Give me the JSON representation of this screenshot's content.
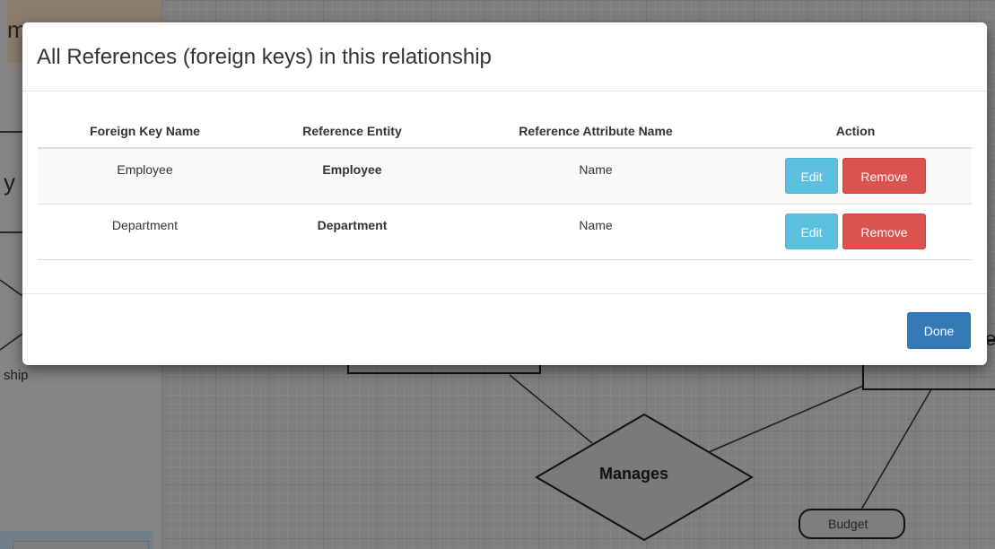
{
  "background": {
    "left_panel": {
      "partial_title": "m",
      "partial_label": "y",
      "partial_text": "ship"
    },
    "diagram": {
      "relationship_label": "Manages",
      "attribute_label": "Budget",
      "partial_entity_text": "e"
    }
  },
  "modal": {
    "title": "All References (foreign keys) in this relationship",
    "table": {
      "headers": [
        "Foreign Key Name",
        "Reference Entity",
        "Reference Attribute Name",
        "Action"
      ],
      "rows": [
        {
          "foreign_key_name": "Employee",
          "reference_entity": "Employee",
          "reference_attribute_name": "Name",
          "edit_label": "Edit",
          "remove_label": "Remove"
        },
        {
          "foreign_key_name": "Department",
          "reference_entity": "Department",
          "reference_attribute_name": "Name",
          "edit_label": "Edit",
          "remove_label": "Remove"
        }
      ]
    },
    "done_label": "Done"
  },
  "colors": {
    "edit_button": "#5bc0de",
    "remove_button": "#d9534f",
    "done_button": "#337ab7",
    "overlay": "#7d7d7d"
  }
}
